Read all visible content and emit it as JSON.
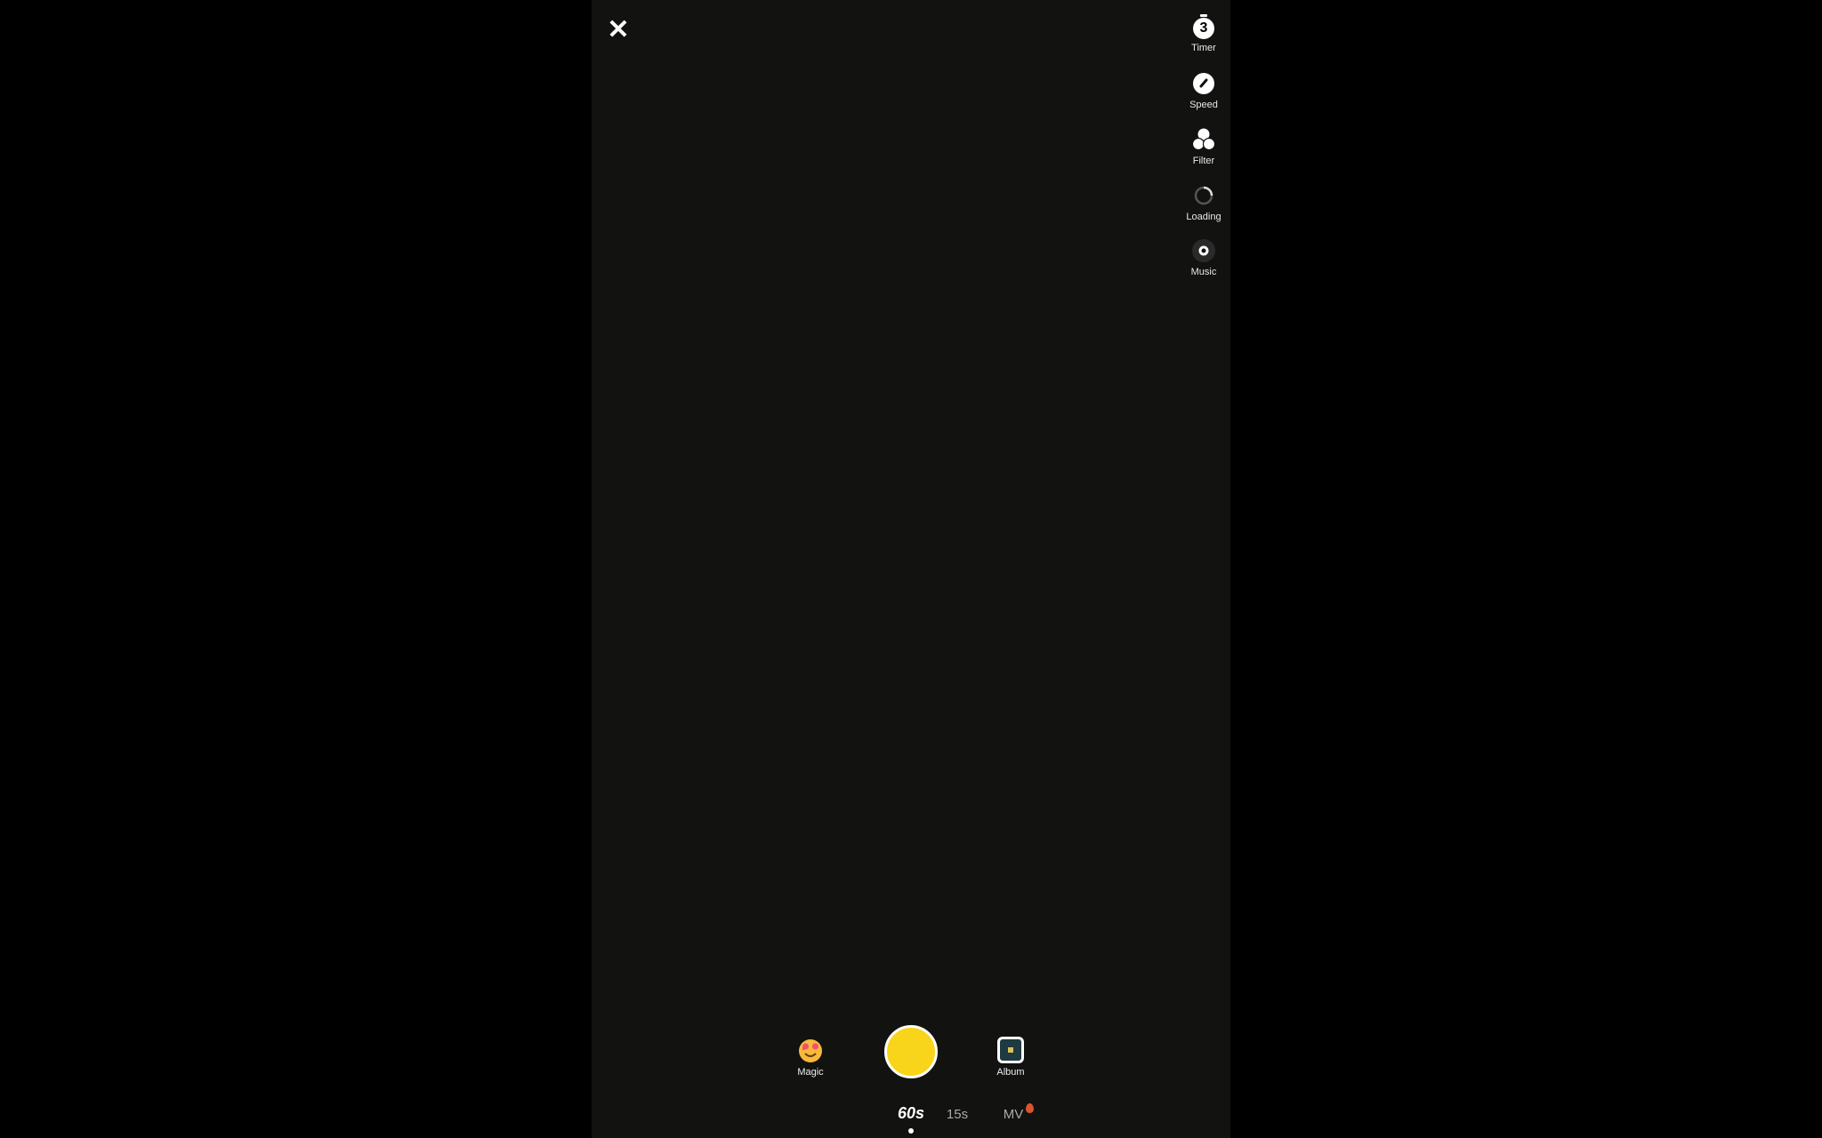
{
  "top": {
    "close_icon": "close-icon"
  },
  "side_tools": [
    {
      "label": "Timer",
      "icon": "timer-icon",
      "value": "3"
    },
    {
      "label": "Speed",
      "icon": "speedometer-icon"
    },
    {
      "label": "Filter",
      "icon": "filter-icon"
    },
    {
      "label": "Loading",
      "icon": "loading-spinner-icon"
    },
    {
      "label": "Music",
      "icon": "music-disc-icon"
    }
  ],
  "bottom": {
    "magic_label": "Magic",
    "album_label": "Album",
    "shutter_color": "#f8d51a",
    "modes": [
      {
        "label": "60s",
        "selected": true
      },
      {
        "label": "15s",
        "selected": false
      },
      {
        "label": "MV",
        "selected": false,
        "badge": "fire-icon"
      }
    ]
  }
}
